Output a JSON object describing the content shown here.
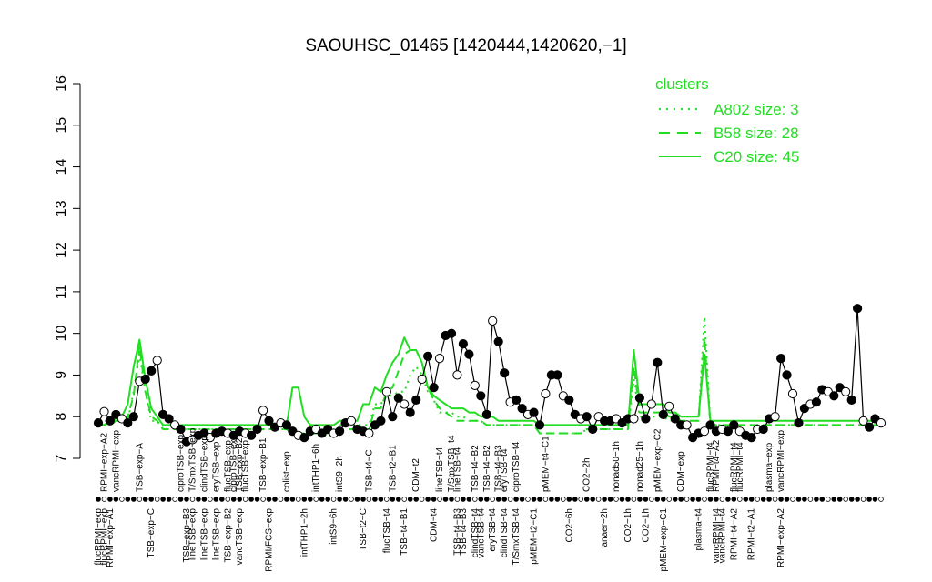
{
  "chart_data": {
    "type": "line",
    "title": "SAOUHSC_01465 [1420444,1420620,−1]",
    "xlabel": "",
    "ylabel": "",
    "ylim": [
      7,
      16
    ],
    "yticks": [
      7,
      8,
      9,
      10,
      11,
      12,
      13,
      14,
      15,
      16
    ],
    "grid": false,
    "legend": {
      "title": "clusters",
      "placement": "top-right",
      "entries": [
        {
          "label": "A802 size: 3",
          "style": "dotted"
        },
        {
          "label": "B58 size: 28",
          "style": "dashed"
        },
        {
          "label": "C20 size: 45",
          "style": "solid"
        }
      ]
    },
    "colors": {
      "cluster": "#22dd22",
      "points": "#000000"
    },
    "top_labels": [
      {
        "i": 1,
        "text": "RPMI−exp−A2"
      },
      {
        "i": 3,
        "text": "vancRPMI−exp"
      },
      {
        "i": 7,
        "text": "TSB−exp−A"
      },
      {
        "i": 14,
        "text": "ciproTSB−exp"
      },
      {
        "i": 16,
        "text": "T/SmxTSB−exp"
      },
      {
        "i": 18,
        "text": "clindTSB−exp"
      },
      {
        "i": 20,
        "text": "eryTSB−exp"
      },
      {
        "i": 22,
        "text": "flucTSB−exp"
      },
      {
        "i": 23,
        "text": "ciproTSB−exp"
      },
      {
        "i": 24,
        "text": "TSB−exp−B2"
      },
      {
        "i": 25,
        "text": "flucTSB−exp"
      },
      {
        "i": 28,
        "text": "TSB−exp−B1"
      },
      {
        "i": 32,
        "text": "colist−exp"
      },
      {
        "i": 37,
        "text": "intTHP1−6h"
      },
      {
        "i": 41,
        "text": "intS9−2h"
      },
      {
        "i": 46,
        "text": "TSB−t4−C"
      },
      {
        "i": 50,
        "text": "TSB−t2−B1"
      },
      {
        "i": 54,
        "text": "CDM−t2"
      },
      {
        "i": 58,
        "text": "lineTSB−t4"
      },
      {
        "i": 60,
        "text": "T/SmxTSB−t4"
      },
      {
        "i": 61,
        "text": "lineTSB−t4"
      },
      {
        "i": 64,
        "text": "TSB−t4−B2"
      },
      {
        "i": 66,
        "text": "TSB−t4−B2"
      },
      {
        "i": 68,
        "text": "TSB−t4−B3"
      },
      {
        "i": 69,
        "text": "eryTSB−t4"
      },
      {
        "i": 71,
        "text": "ciproTSB−t4"
      },
      {
        "i": 76,
        "text": "pMEM−t4−C1"
      },
      {
        "i": 83,
        "text": "CO2−2h"
      },
      {
        "i": 88,
        "text": "nonad50−1h"
      },
      {
        "i": 92,
        "text": "nonad25−1h"
      },
      {
        "i": 95,
        "text": "pMEM−exp−C2"
      },
      {
        "i": 99,
        "text": "CDM−exp"
      },
      {
        "i": 104,
        "text": "flucRPMI−t4"
      },
      {
        "i": 105,
        "text": "RPMI−t4−A2"
      },
      {
        "i": 108,
        "text": "flucRPMI−t4"
      },
      {
        "i": 109,
        "text": "flucRPMI−t4"
      },
      {
        "i": 114,
        "text": "plasma−exp"
      },
      {
        "i": 116,
        "text": "vancRPMI−exp"
      }
    ],
    "bottom_labels": [
      {
        "i": 0,
        "text": "flucRPMI−exp"
      },
      {
        "i": 1,
        "text": "flucRPMI−exp"
      },
      {
        "i": 2,
        "text": "RPMI−exp−A1"
      },
      {
        "i": 9,
        "text": "TSB−exp−C"
      },
      {
        "i": 15,
        "text": "TSB−exp−B3"
      },
      {
        "i": 16,
        "text": "lineTSB−exp"
      },
      {
        "i": 18,
        "text": "lineTSB−exp"
      },
      {
        "i": 20,
        "text": "lineTSB−exp"
      },
      {
        "i": 22,
        "text": "TSB−exp−B2"
      },
      {
        "i": 24,
        "text": "vancTSB−exp"
      },
      {
        "i": 29,
        "text": "RPMI/FCS−exp"
      },
      {
        "i": 35,
        "text": "intTHP1−2h"
      },
      {
        "i": 40,
        "text": "intS9−6h"
      },
      {
        "i": 45,
        "text": "TSB−t2−C"
      },
      {
        "i": 49,
        "text": "flucTSB−t4"
      },
      {
        "i": 52,
        "text": "TSB−t4−B1"
      },
      {
        "i": 57,
        "text": "CDM−t4"
      },
      {
        "i": 61,
        "text": "TSB−t4−B3"
      },
      {
        "i": 62,
        "text": "TSB−t4−B3"
      },
      {
        "i": 64,
        "text": "clindTSB−t4"
      },
      {
        "i": 65,
        "text": "vancTSB−t4"
      },
      {
        "i": 67,
        "text": "eryTSB−t4"
      },
      {
        "i": 69,
        "text": "clindTSB−t4"
      },
      {
        "i": 71,
        "text": "T/SmxTSB−t4"
      },
      {
        "i": 74,
        "text": "pMEM−t2−C1"
      },
      {
        "i": 80,
        "text": "CO2−6h"
      },
      {
        "i": 86,
        "text": "anaer−2h"
      },
      {
        "i": 90,
        "text": "CO2−1h"
      },
      {
        "i": 93,
        "text": "CO2−1h"
      },
      {
        "i": 96,
        "text": "pMEM−exp−C1"
      },
      {
        "i": 102,
        "text": "plasma−t4"
      },
      {
        "i": 105,
        "text": "vancRPMI−t4"
      },
      {
        "i": 106,
        "text": "vancRPMI−t4"
      },
      {
        "i": 108,
        "text": "RPMI−t4−A2"
      },
      {
        "i": 111,
        "text": "RPMI−t2−A1"
      },
      {
        "i": 116,
        "text": "RPMI−exp−A2"
      }
    ],
    "values": [
      7.85,
      8.12,
      7.9,
      8.05,
      7.95,
      7.85,
      8.0,
      8.85,
      8.9,
      9.1,
      9.35,
      8.05,
      7.95,
      7.8,
      7.7,
      7.4,
      7.45,
      7.55,
      7.6,
      7.5,
      7.6,
      7.65,
      7.6,
      7.55,
      7.65,
      7.6,
      7.55,
      7.7,
      8.15,
      7.9,
      7.75,
      7.85,
      7.8,
      7.65,
      7.55,
      7.5,
      7.65,
      7.7,
      7.6,
      7.7,
      7.6,
      7.65,
      7.85,
      7.9,
      7.7,
      7.65,
      7.6,
      7.8,
      7.9,
      8.6,
      8.0,
      8.45,
      8.3,
      8.1,
      8.4,
      8.9,
      9.45,
      8.7,
      9.4,
      9.95,
      10.0,
      9.0,
      9.75,
      9.5,
      8.75,
      8.5,
      8.05,
      10.3,
      9.8,
      9.05,
      8.35,
      8.4,
      8.2,
      8.05,
      8.1,
      7.8,
      8.55,
      9.0,
      9.0,
      8.5,
      8.4,
      8.05,
      7.95,
      8.0,
      7.7,
      8.0,
      7.9,
      7.9,
      7.95,
      7.85,
      7.95,
      7.95,
      8.45,
      7.95,
      8.3,
      9.3,
      8.05,
      8.25,
      7.95,
      7.8,
      7.8,
      7.5,
      7.6,
      7.65,
      7.8,
      7.65,
      7.7,
      7.65,
      7.8,
      7.65,
      7.55,
      7.5,
      7.7,
      7.7,
      7.95,
      8.0,
      9.4,
      9.0,
      8.55,
      7.85,
      8.2,
      8.3,
      8.35,
      8.65,
      8.6,
      8.5,
      8.7,
      8.6,
      8.4,
      10.6,
      7.9,
      7.75,
      7.95,
      7.85
    ],
    "series": [
      {
        "style": "dotted",
        "values": [
          7.9,
          7.9,
          7.9,
          7.9,
          7.9,
          7.9,
          8.6,
          9.5,
          8.6,
          7.9,
          7.9,
          7.7,
          7.7,
          7.7,
          7.7,
          7.7,
          7.7,
          7.7,
          7.7,
          7.7,
          7.7,
          7.7,
          7.7,
          7.7,
          7.7,
          7.7,
          7.7,
          7.7,
          7.7,
          7.7,
          7.7,
          7.7,
          7.7,
          7.6,
          7.6,
          7.6,
          7.6,
          7.6,
          7.6,
          7.6,
          7.6,
          7.8,
          7.8,
          7.8,
          7.8,
          7.8,
          7.8,
          8.3,
          8.3,
          8.5,
          8.5,
          8.6,
          8.6,
          9.0,
          9.2,
          9.0,
          8.6,
          8.4,
          8.1,
          8.1,
          8.1,
          8.0,
          8.0,
          7.9,
          7.9,
          7.9,
          7.8,
          7.8,
          7.8,
          7.8,
          7.8,
          7.8,
          7.8,
          7.8,
          7.8,
          7.6,
          7.6,
          7.6,
          7.6,
          7.6,
          7.6,
          7.6,
          7.6,
          7.7,
          7.7,
          7.7,
          7.7,
          7.7,
          7.7,
          7.7,
          7.7,
          8.9,
          8.0,
          8.0,
          8.0,
          8.0,
          8.0,
          7.9,
          7.9,
          7.9,
          7.9,
          7.9,
          7.9,
          10.4,
          7.8,
          7.8,
          7.8,
          7.8,
          7.8,
          7.8,
          7.8,
          7.8,
          7.8,
          7.8,
          7.8,
          7.8,
          7.8,
          7.8,
          7.8,
          7.8,
          7.8,
          7.8,
          7.8,
          7.8,
          7.8,
          7.8,
          7.8,
          7.8,
          7.8,
          7.8,
          7.8,
          7.8,
          7.8,
          7.8
        ]
      },
      {
        "style": "dashed",
        "values": [
          7.8,
          7.8,
          7.8,
          7.9,
          7.9,
          8.0,
          8.5,
          9.7,
          8.6,
          8.0,
          7.9,
          7.7,
          7.7,
          7.7,
          7.7,
          7.7,
          7.7,
          7.7,
          7.7,
          7.7,
          7.7,
          7.7,
          7.7,
          7.7,
          7.7,
          7.7,
          7.7,
          7.7,
          7.7,
          7.7,
          7.7,
          7.7,
          7.7,
          7.6,
          7.6,
          7.6,
          7.6,
          7.6,
          7.6,
          7.6,
          7.6,
          7.7,
          7.7,
          7.7,
          7.7,
          7.7,
          7.7,
          8.2,
          8.2,
          8.6,
          8.7,
          9.1,
          9.5,
          9.6,
          9.6,
          9.3,
          8.7,
          8.4,
          8.2,
          8.1,
          8.0,
          7.9,
          7.9,
          7.9,
          7.9,
          7.9,
          7.8,
          7.8,
          7.8,
          7.8,
          7.8,
          7.8,
          7.8,
          7.8,
          7.8,
          7.6,
          7.6,
          7.6,
          7.6,
          7.6,
          7.6,
          7.6,
          7.6,
          7.7,
          7.7,
          7.7,
          7.7,
          7.7,
          7.7,
          7.7,
          7.7,
          9.2,
          8.1,
          8.1,
          8.1,
          8.1,
          8.1,
          8.0,
          8.0,
          7.9,
          7.9,
          7.9,
          7.9,
          9.9,
          7.8,
          7.8,
          7.8,
          7.8,
          7.8,
          7.8,
          7.8,
          7.8,
          7.8,
          7.8,
          7.8,
          7.8,
          7.8,
          7.8,
          7.8,
          7.8,
          7.8,
          7.8,
          7.8,
          7.8,
          7.8,
          7.8,
          7.8,
          7.8,
          7.8,
          7.8,
          7.8,
          7.8,
          7.8,
          7.8
        ]
      },
      {
        "style": "solid",
        "values": [
          7.8,
          7.8,
          7.9,
          7.95,
          8.0,
          8.3,
          9.2,
          9.85,
          8.9,
          8.2,
          8.0,
          7.8,
          7.8,
          7.8,
          7.8,
          7.8,
          7.8,
          7.8,
          7.8,
          7.8,
          7.8,
          7.8,
          7.8,
          7.8,
          7.8,
          7.8,
          7.8,
          7.8,
          7.8,
          7.8,
          7.8,
          7.8,
          7.8,
          8.7,
          8.7,
          8.0,
          7.8,
          7.8,
          7.8,
          7.8,
          7.8,
          7.9,
          7.9,
          7.9,
          7.9,
          8.3,
          8.3,
          8.7,
          8.6,
          9.0,
          9.3,
          9.5,
          9.9,
          9.6,
          9.6,
          9.3,
          8.7,
          8.5,
          8.4,
          8.3,
          8.2,
          8.2,
          8.2,
          8.1,
          8.1,
          8.0,
          8.0,
          8.0,
          7.9,
          7.9,
          7.9,
          7.9,
          7.9,
          7.9,
          7.9,
          7.8,
          7.8,
          7.8,
          7.8,
          7.8,
          7.8,
          7.8,
          7.8,
          7.8,
          7.8,
          7.8,
          7.8,
          7.8,
          7.8,
          7.8,
          7.8,
          9.6,
          8.3,
          8.3,
          8.3,
          8.3,
          8.3,
          8.1,
          8.1,
          8.0,
          8.0,
          8.0,
          8.0,
          9.5,
          7.9,
          7.9,
          7.9,
          7.9,
          7.9,
          7.9,
          7.9,
          7.9,
          7.9,
          7.9,
          7.9,
          7.9,
          7.9,
          7.9,
          7.9,
          7.9,
          7.9,
          7.9,
          7.9,
          7.9,
          7.9,
          7.9,
          7.9,
          7.9,
          7.9,
          7.9,
          7.9,
          7.9,
          7.9,
          7.9
        ]
      }
    ]
  }
}
